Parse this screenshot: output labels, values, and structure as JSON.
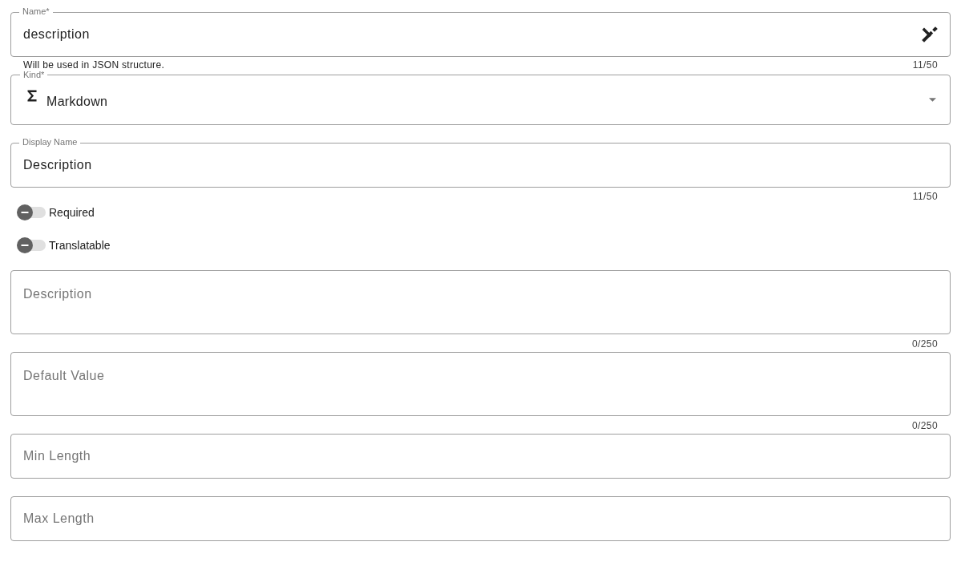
{
  "name_field": {
    "label": "Name*",
    "value": "description",
    "hint": "Will be used in JSON structure.",
    "counter": "11/50"
  },
  "kind_field": {
    "label": "Kind*",
    "value": "Markdown"
  },
  "display_name_field": {
    "label": "Display Name",
    "value": "Description",
    "counter": "11/50"
  },
  "toggles": [
    {
      "label": "Required",
      "on": false
    },
    {
      "label": "Translatable",
      "on": false
    }
  ],
  "text_areas": [
    {
      "placeholder": "Description",
      "counter": "0/250"
    },
    {
      "placeholder": "Default Value",
      "counter": "0/250"
    }
  ],
  "number_fields": [
    {
      "placeholder": "Min Length"
    },
    {
      "placeholder": "Max Length"
    }
  ]
}
